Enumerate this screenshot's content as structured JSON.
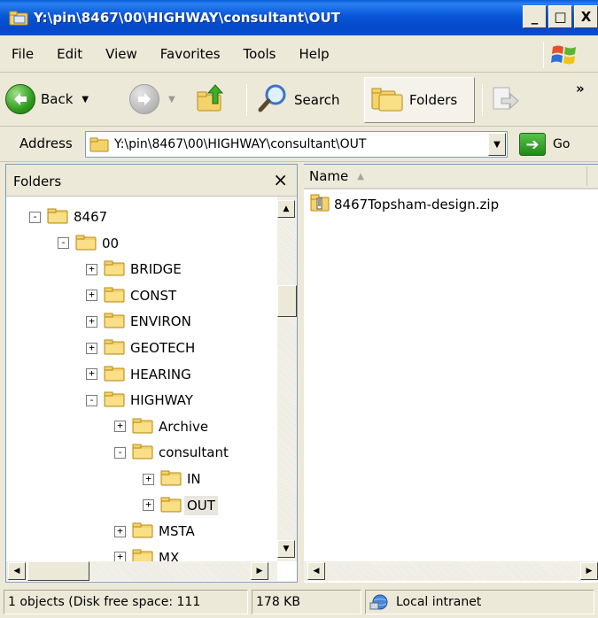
{
  "window": {
    "title": "Y:\\pin\\8467\\00\\HIGHWAY\\consultant\\OUT"
  },
  "caption_buttons": {
    "minimize": "_",
    "maximize": "□",
    "close": "X"
  },
  "menu": [
    "File",
    "Edit",
    "View",
    "Favorites",
    "Tools",
    "Help"
  ],
  "toolbar": {
    "back_label": "Back",
    "search_label": "Search",
    "folders_label": "Folders",
    "chevron": "»"
  },
  "address": {
    "label": "Address",
    "value": "Y:\\pin\\8467\\00\\HIGHWAY\\consultant\\OUT",
    "go_label": "Go"
  },
  "folder_pane": {
    "title": "Folders",
    "close_glyph": "×",
    "tree": [
      {
        "label": "8467",
        "state": "-"
      },
      {
        "label": "00",
        "state": "-"
      },
      {
        "label": "BRIDGE",
        "state": "+"
      },
      {
        "label": "CONST",
        "state": "+"
      },
      {
        "label": "ENVIRON",
        "state": "+"
      },
      {
        "label": "GEOTECH",
        "state": "+"
      },
      {
        "label": "HEARING",
        "state": "+"
      },
      {
        "label": "HIGHWAY",
        "state": "-"
      },
      {
        "label": "Archive",
        "state": "+"
      },
      {
        "label": "consultant",
        "state": "-"
      },
      {
        "label": "IN",
        "state": "+"
      },
      {
        "label": "OUT",
        "state": "+",
        "selected": true
      },
      {
        "label": "MSTA",
        "state": "+"
      },
      {
        "label": "MX",
        "state": "+"
      }
    ]
  },
  "file_list": {
    "column_name": "Name",
    "files": [
      {
        "name": "8467Topsham-design.zip",
        "icon": "zip-folder-icon"
      }
    ]
  },
  "status": {
    "objects": "1 objects (Disk free space: 111",
    "size": "178 KB",
    "zone": "Local intranet"
  },
  "colors": {
    "titlebar": "#0a5bd8",
    "chrome": "#ece9d8",
    "folder": "#f5d36b"
  }
}
